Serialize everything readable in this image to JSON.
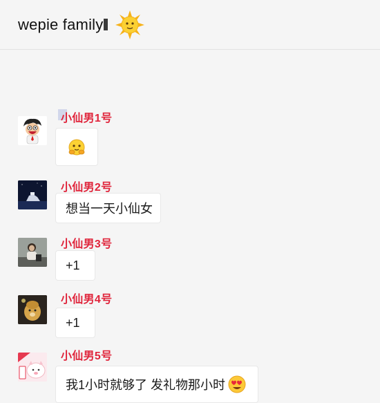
{
  "chat": {
    "title": "wepie family",
    "title_emoji": "sun-emoji"
  },
  "messages": [
    {
      "sender": "小仙男1号",
      "text": "",
      "emoji": "hugging-face-emoji"
    },
    {
      "sender": "小仙男2号",
      "text": "想当一天小仙女"
    },
    {
      "sender": "小仙男3号",
      "text": "+1"
    },
    {
      "sender": "小仙男4号",
      "text": "+1"
    },
    {
      "sender": "小仙男5号",
      "text": "我1小时就够了 发礼物那小时",
      "emoji": "heart-eyes-emoji"
    }
  ],
  "colors": {
    "sender_name": "#e0253c",
    "bubble_bg": "#ffffff",
    "page_bg": "#f5f5f5"
  }
}
